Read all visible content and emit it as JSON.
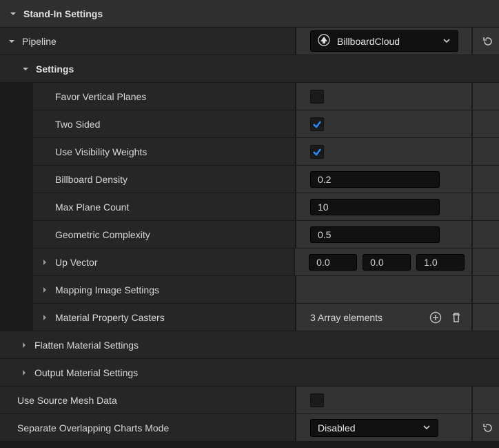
{
  "header": {
    "title": "Stand-In Settings"
  },
  "pipeline": {
    "label": "Pipeline",
    "value": "BillboardCloud"
  },
  "settings": {
    "label": "Settings",
    "props": {
      "favorVerticalPlanes": {
        "label": "Favor Vertical Planes",
        "checked": false
      },
      "twoSided": {
        "label": "Two Sided",
        "checked": true
      },
      "useVisibilityWeights": {
        "label": "Use Visibility Weights",
        "checked": true
      },
      "billboardDensity": {
        "label": "Billboard Density",
        "value": "0.2"
      },
      "maxPlaneCount": {
        "label": "Max Plane Count",
        "value": "10"
      },
      "geometricComplexity": {
        "label": "Geometric Complexity",
        "value": "0.5"
      },
      "upVector": {
        "label": "Up Vector",
        "x": "0.0",
        "y": "0.0",
        "z": "1.0"
      },
      "mappingImageSettings": {
        "label": "Mapping Image Settings"
      },
      "materialPropertyCasters": {
        "label": "Material Property Casters",
        "arrayText": "3 Array elements"
      }
    }
  },
  "flattenMaterial": {
    "label": "Flatten Material Settings"
  },
  "outputMaterial": {
    "label": "Output Material Settings"
  },
  "useSourceMeshData": {
    "label": "Use Source Mesh Data",
    "checked": false
  },
  "separateOverlapping": {
    "label": "Separate Overlapping Charts Mode",
    "value": "Disabled"
  }
}
